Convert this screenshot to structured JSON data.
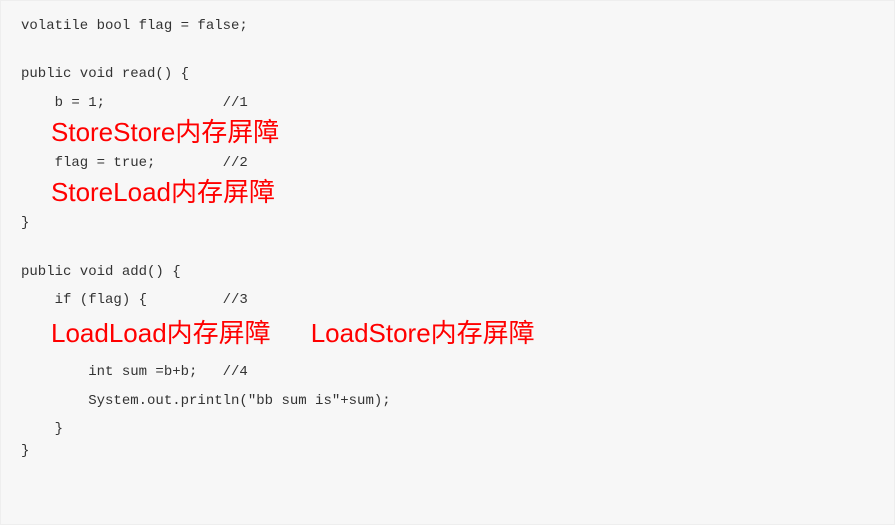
{
  "code": {
    "l1": "volatile bool flag = false;",
    "l2": "",
    "l3": "public void read() {",
    "l4": "    b = 1;              //1",
    "l5": "    flag = true;        //2",
    "l6": "}",
    "l7": "",
    "l8": "public void add() {",
    "l9": "    if (flag) {         //3",
    "l10": "        int sum =b+b;   //4",
    "l11": "        System.out.println(\"bb sum is\"+sum);",
    "l12": "    }",
    "l13": "}"
  },
  "annotations": {
    "storestore": "StoreStore内存屏障",
    "storeload": "StoreLoad内存屏障",
    "loadload": "LoadLoad内存屏障",
    "loadstore": "LoadStore内存屏障"
  }
}
